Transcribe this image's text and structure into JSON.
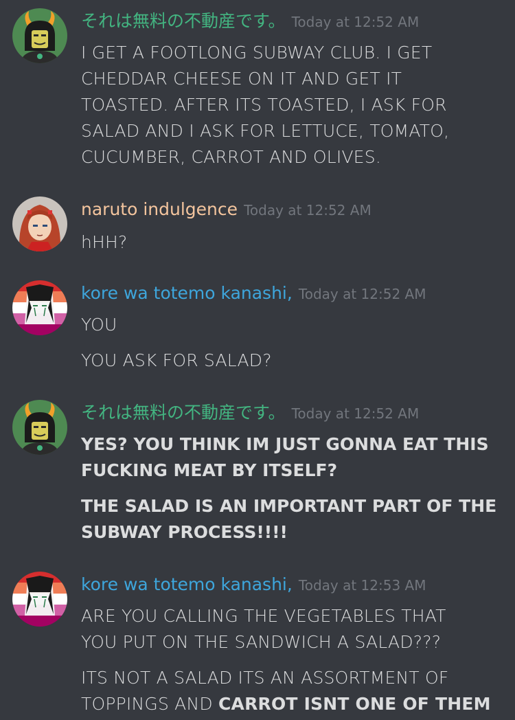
{
  "colors": {
    "background": "#36393f",
    "text": "#dcddde",
    "timestamp": "#72767d",
    "user_green": "#43b581",
    "user_peach": "#f4c59e",
    "user_blue": "#3ea6dc"
  },
  "messages": [
    {
      "username": "それは無料の不動産です。",
      "timestamp": "Today at 12:52 AM",
      "avatar": "horned-troll-avatar",
      "lines": [
        "I GET A FOOTLONG SUBWAY CLUB. I GET",
        "CHEDDAR CHEESE ON IT AND GET IT",
        "TOASTED. AFTER ITS TOASTED, I ASK FOR",
        "SALAD AND I ASK FOR LETTUCE, TOMATO,",
        "CUCUMBER, CARROT AND OLIVES."
      ]
    },
    {
      "username": "naruto indulgence",
      "timestamp": "Today at 12:52 AM",
      "avatar": "red-hair-anime-avatar",
      "lines": [
        "hHH?"
      ]
    },
    {
      "username": "kore wa totemo kanashi,",
      "timestamp": "Today at 12:52 AM",
      "avatar": "pink-stripe-anime-avatar",
      "lines": [
        "YOU",
        "YOU ASK FOR SALAD?"
      ]
    },
    {
      "username": "それは無料の不動産です。",
      "timestamp": "Today at 12:52 AM",
      "avatar": "horned-troll-avatar",
      "lines": [
        "YES? YOU THINK IM JUST GONNA EAT THIS",
        "FUCKING MEAT BY ITSELF?",
        "THE SALAD IS AN IMPORTANT PART OF THE",
        "SUBWAY PROCESS!!!!"
      ]
    },
    {
      "username": "kore wa totemo kanashi,",
      "timestamp": "Today at 12:53 AM",
      "avatar": "pink-stripe-anime-avatar",
      "lines": [
        "ARE YOU CALLING THE VEGETABLES THAT",
        "YOU PUT ON THE SANDWICH A SALAD???",
        "ITS NOT A SALAD ITS AN ASSORTMENT OF",
        "TOPPINGS AND "
      ],
      "bold_tail": "CARROT ISNT ONE OF THEM"
    }
  ]
}
